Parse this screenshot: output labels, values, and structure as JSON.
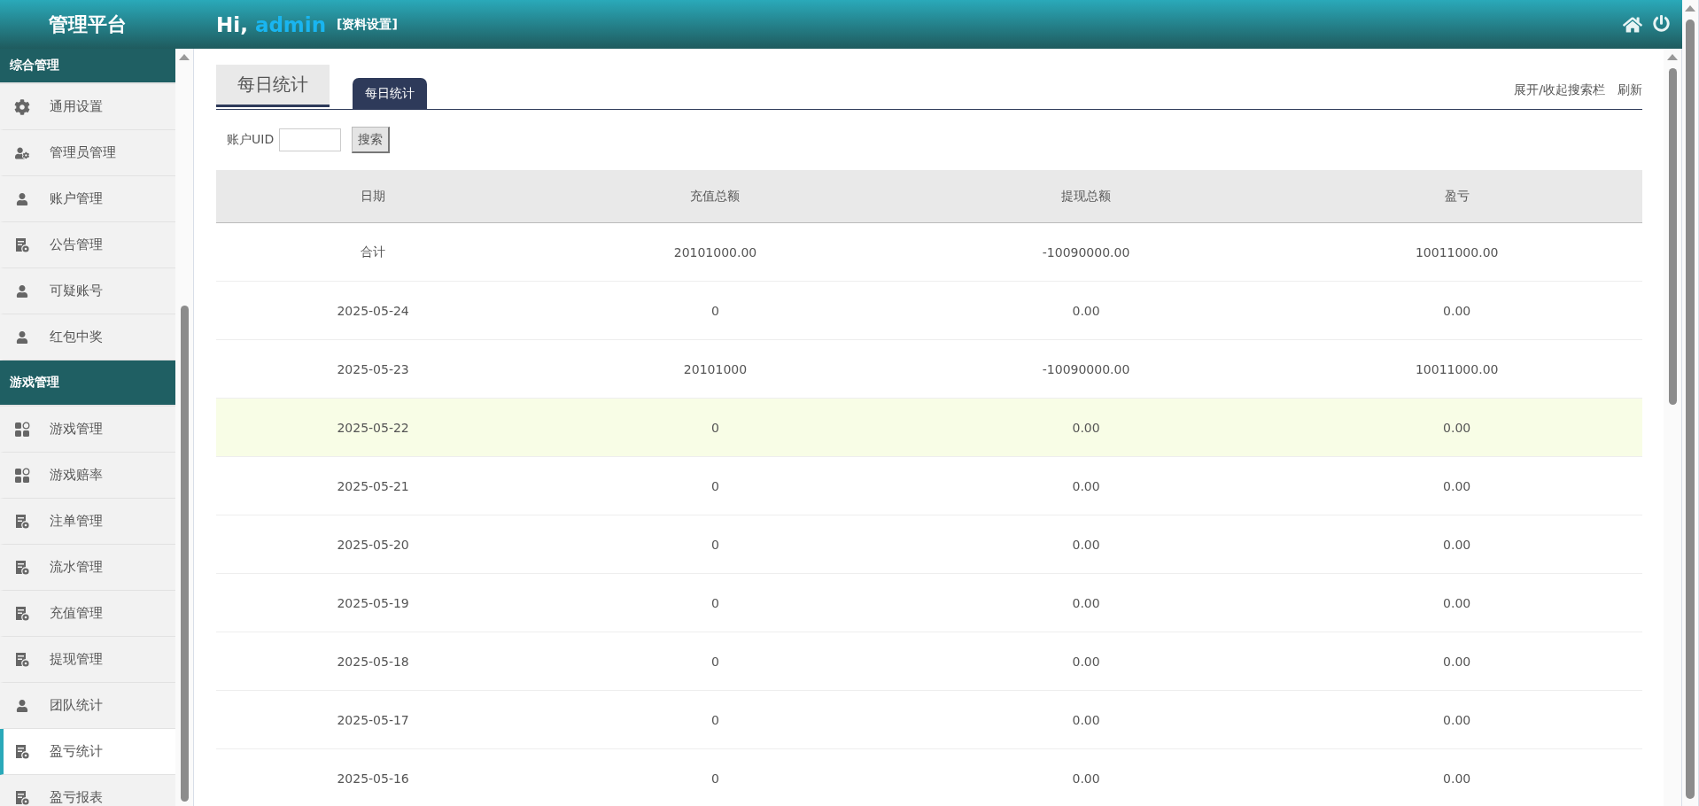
{
  "header": {
    "title": "管理平台",
    "greeting": "Hi,",
    "user": "admin",
    "profile_link": "[资料设置]"
  },
  "sidebar": {
    "groups": [
      {
        "title": "综合管理",
        "items": [
          {
            "label": "通用设置",
            "kind": "gear",
            "selected": false
          },
          {
            "label": "管理员管理",
            "kind": "admin",
            "selected": false
          },
          {
            "label": "账户管理",
            "kind": "person",
            "selected": false
          },
          {
            "label": "公告管理",
            "kind": "record",
            "selected": false
          },
          {
            "label": "可疑账号",
            "kind": "person",
            "selected": false
          },
          {
            "label": "红包中奖",
            "kind": "person",
            "selected": false
          }
        ]
      },
      {
        "title": "游戏管理",
        "items": [
          {
            "label": "游戏管理",
            "kind": "game",
            "selected": false
          },
          {
            "label": "游戏赔率",
            "kind": "game",
            "selected": false
          },
          {
            "label": "注单管理",
            "kind": "record",
            "selected": false
          },
          {
            "label": "流水管理",
            "kind": "record",
            "selected": false
          },
          {
            "label": "充值管理",
            "kind": "record",
            "selected": false
          },
          {
            "label": "提现管理",
            "kind": "record",
            "selected": false
          },
          {
            "label": "团队统计",
            "kind": "person",
            "selected": false
          },
          {
            "label": "盈亏统计",
            "kind": "record",
            "selected": true
          },
          {
            "label": "盈亏报表",
            "kind": "record",
            "selected": false
          }
        ]
      }
    ]
  },
  "page": {
    "title": "每日统计",
    "tabs": [
      {
        "label": "每日统计",
        "selected": true
      }
    ],
    "links": [
      "展开/收起搜索栏",
      "刷新"
    ],
    "search": {
      "label": "账户UID",
      "button": "搜索"
    }
  },
  "table": {
    "columns": [
      "日期",
      "充值总额",
      "提现总额",
      "盈亏"
    ],
    "rows": [
      {
        "cells": [
          "合计",
          "20101000.00",
          "-10090000.00",
          "10011000.00"
        ],
        "highlighted": false
      },
      {
        "cells": [
          "2025-05-24",
          "0",
          "0.00",
          "0.00"
        ],
        "highlighted": false
      },
      {
        "cells": [
          "2025-05-23",
          "20101000",
          "-10090000.00",
          "10011000.00"
        ],
        "highlighted": false
      },
      {
        "cells": [
          "2025-05-22",
          "0",
          "0.00",
          "0.00"
        ],
        "highlighted": true
      },
      {
        "cells": [
          "2025-05-21",
          "0",
          "0.00",
          "0.00"
        ],
        "highlighted": false
      },
      {
        "cells": [
          "2025-05-20",
          "0",
          "0.00",
          "0.00"
        ],
        "highlighted": false
      },
      {
        "cells": [
          "2025-05-19",
          "0",
          "0.00",
          "0.00"
        ],
        "highlighted": false
      },
      {
        "cells": [
          "2025-05-18",
          "0",
          "0.00",
          "0.00"
        ],
        "highlighted": false
      },
      {
        "cells": [
          "2025-05-17",
          "0",
          "0.00",
          "0.00"
        ],
        "highlighted": false
      },
      {
        "cells": [
          "2025-05-16",
          "0",
          "0.00",
          "0.00"
        ],
        "highlighted": false
      }
    ]
  }
}
